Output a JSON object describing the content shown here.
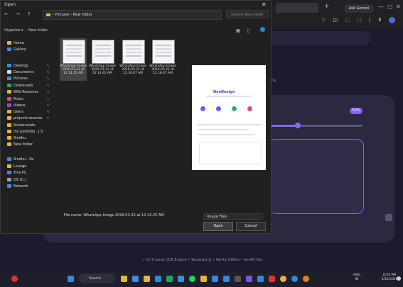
{
  "browser": {
    "tab_label": "",
    "new_tab": "+",
    "gemini_button": "Ask Gemini",
    "window_controls": [
      "—",
      "▢",
      "✕"
    ]
  },
  "webpage": {
    "context_text": "rors.",
    "percent_badge": "50%",
    "slider_value": 0.3,
    "footer": "✓ v7.0 Local OCR Engine • Tesseract.js • Works Offline • No API Key"
  },
  "dialog": {
    "title": "Open",
    "close": "✕",
    "breadcrumb": "› Pictures › New folder",
    "search_placeholder": "Search New folder",
    "organize": "Organize ▾",
    "new_folder": "New folder",
    "nav_items": [
      {
        "label": "Home",
        "color": "#e8b53c",
        "pinned": false
      },
      {
        "label": "Gallery",
        "color": "#3b8de0",
        "pinned": false
      },
      {
        "label": "Desktop",
        "color": "#3b8de0",
        "pinned": true
      },
      {
        "label": "Documents",
        "color": "#dddddd",
        "pinned": true
      },
      {
        "label": "Pictures",
        "color": "#3b8de0",
        "pinned": true
      },
      {
        "label": "Downloads",
        "color": "#2aa56a",
        "pinned": true
      },
      {
        "label": "Wild Resumes",
        "color": "#e8b53c",
        "pinned": true
      },
      {
        "label": "Music",
        "color": "#e04a7a",
        "pinned": true
      },
      {
        "label": "Videos",
        "color": "#7a52d8",
        "pinned": true
      },
      {
        "label": "Users",
        "color": "#e8b53c",
        "pinned": true
      },
      {
        "label": "projects resume",
        "color": "#e8b53c",
        "pinned": true
      },
      {
        "label": "Screenshots",
        "color": "#e8b53c",
        "pinned": false
      },
      {
        "label": "my portfolio .1.5",
        "color": "#e8b53c",
        "pinned": false
      },
      {
        "label": "Sindhu",
        "color": "#e8b53c",
        "pinned": false
      },
      {
        "label": "New folder",
        "color": "#e8b53c",
        "pinned": false
      },
      {
        "label": "",
        "color": "transparent",
        "pinned": false
      },
      {
        "label": "Sindhu - Pe",
        "color": "#3b8de0",
        "pinned": false
      },
      {
        "label": "Lounge",
        "color": "#e8b53c",
        "pinned": false
      },
      {
        "label": "This PC",
        "color": "#3b8de0",
        "pinned": false
      },
      {
        "label": "OS (C:)",
        "color": "#9aa3b0",
        "pinned": false
      },
      {
        "label": "Network",
        "color": "#3b8de0",
        "pinned": false
      }
    ],
    "files": [
      {
        "name": "WhatsApp Image 2026-03-22 at 12.14.25 AM",
        "selected": true
      },
      {
        "name": "WhatsApp Image 2026-03-22 at 12.14.41 AM",
        "selected": false
      },
      {
        "name": "WhatsApp Image 2026-03-22 at 12.16.07 AM",
        "selected": false
      },
      {
        "name": "WhatsApp Image 2026-03-22 at 12.16.47 AM",
        "selected": false
      }
    ],
    "preview_title": "NeoDesign",
    "file_name_label": "File name:",
    "file_name_value": "WhatsApp Image 2026-03-22 at 12.14.25 AM",
    "file_type": "Image Files",
    "open_button": "Open",
    "cancel_button": "Cancel"
  },
  "taskbar": {
    "search": "Search",
    "tray_lang": "ENG\nIN",
    "time": "8:54 PM",
    "date": "3/22/2026"
  }
}
